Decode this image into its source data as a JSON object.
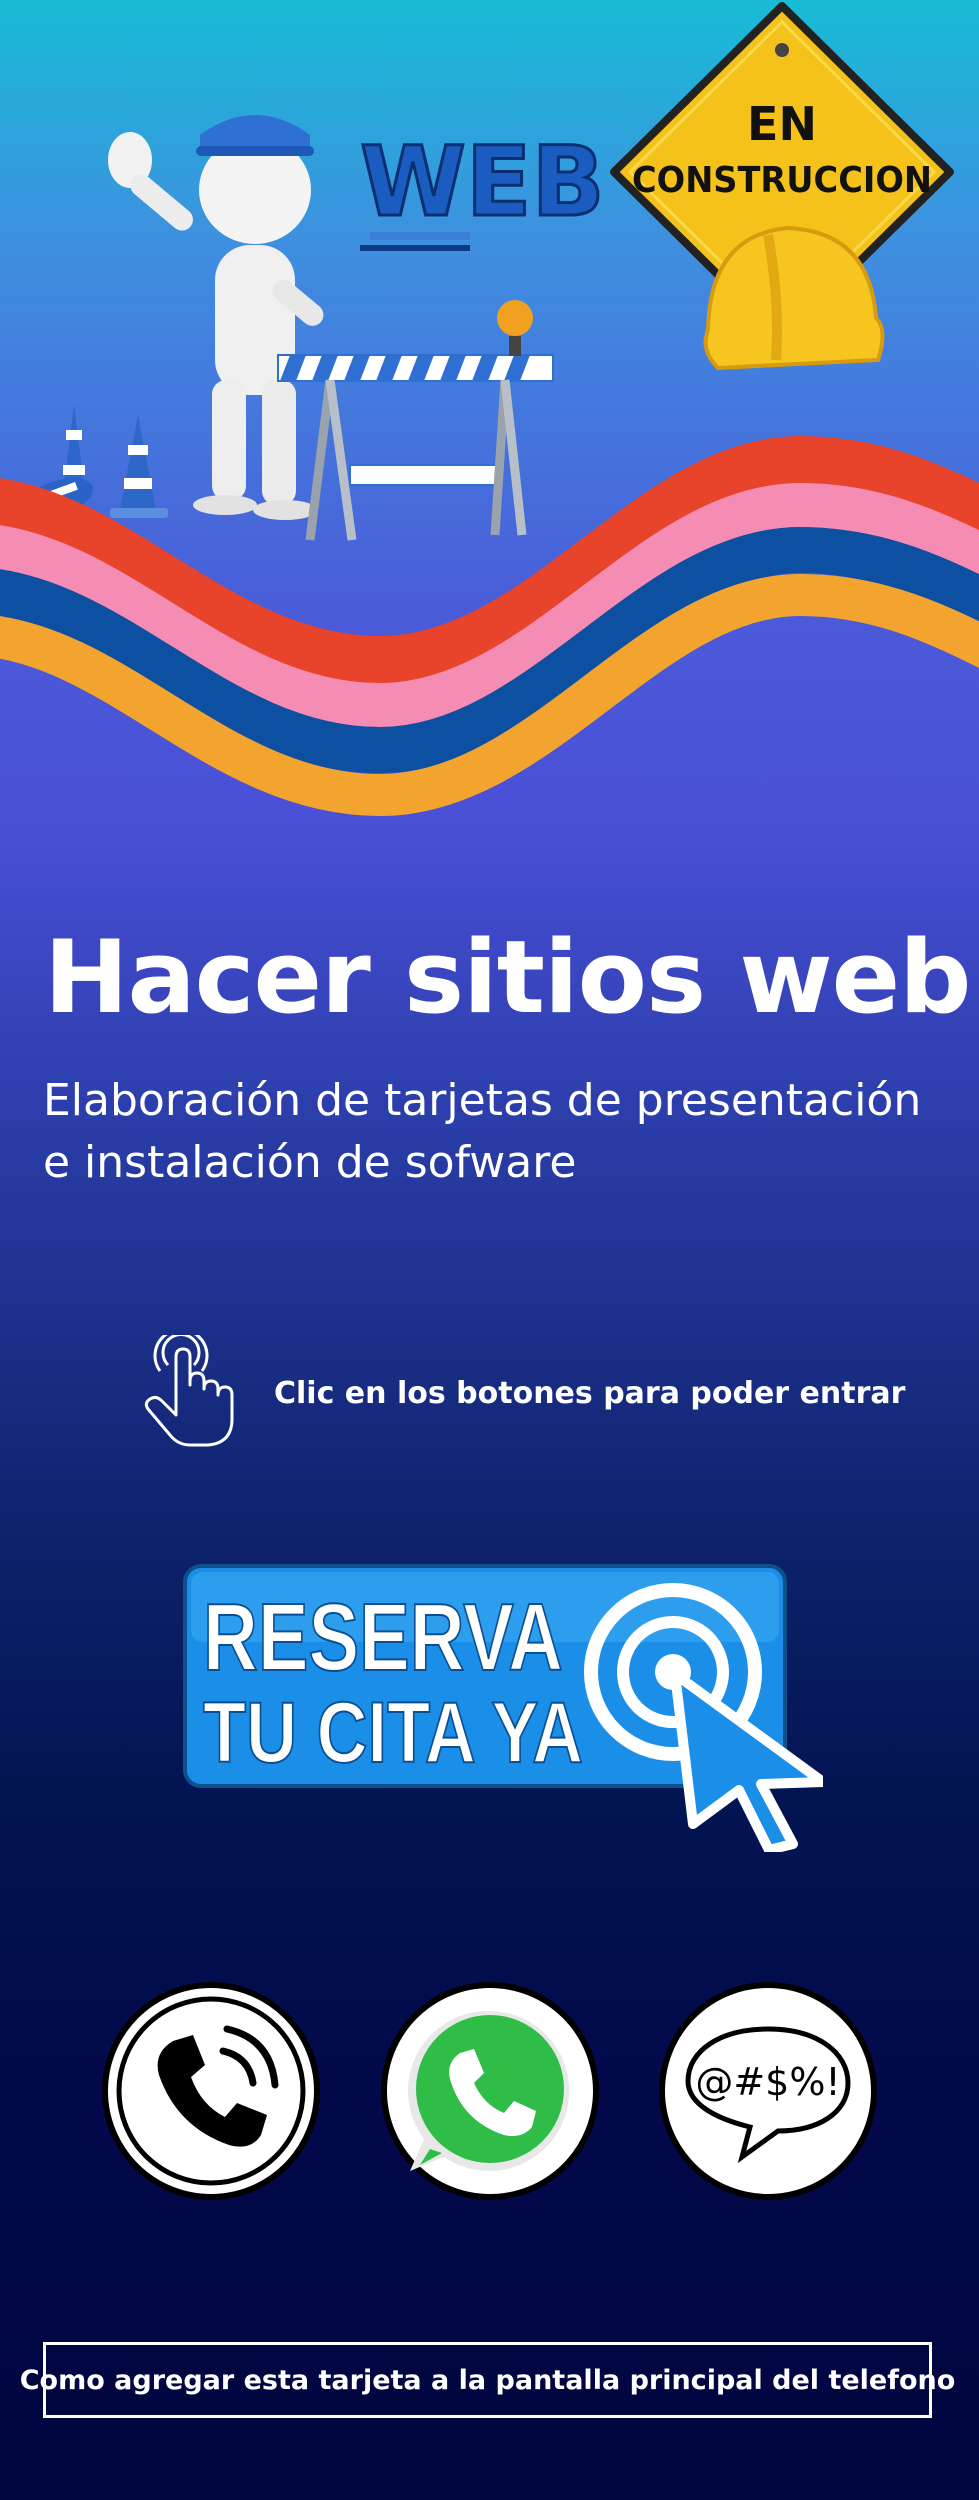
{
  "hero": {
    "image": {
      "web_label": "WEB",
      "sign_line1": "EN",
      "sign_line2": "CONSTRUCCION"
    },
    "title": "Hacer sitios web",
    "subtitle": "Elaboración de tarjetas de presentación e instalación de sofware"
  },
  "hint": {
    "icon": "hand-pointer-icon",
    "text": "Clic en los botones para poder entrar"
  },
  "reserve_button": {
    "line1": "RESERVA",
    "line2": "TU CITA YA"
  },
  "contact_buttons": [
    {
      "icon": "phone-icon"
    },
    {
      "icon": "whatsapp-icon"
    },
    {
      "icon": "chat-bubble-icon",
      "text": "@#$%!"
    }
  ],
  "footer": {
    "install_link": "Como agregar esta tarjeta a la pantalla principal del telefono"
  },
  "colors": {
    "wave_red": "#e8432b",
    "wave_pink": "#f58cb4",
    "wave_blue": "#0d4fa0",
    "wave_orange": "#f2a42e",
    "button_blue": "#1b8fe8",
    "whatsapp_green": "#2fbd47",
    "sign_yellow": "#f4c21b"
  }
}
